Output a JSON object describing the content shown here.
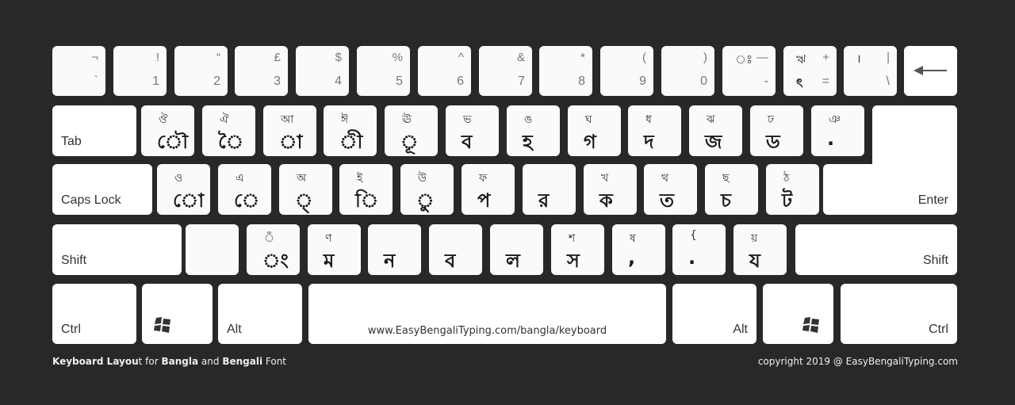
{
  "rows": {
    "number": [
      {
        "shift": "¬",
        "base": "`",
        "bangla": true
      },
      {
        "shift": "!",
        "base": "1"
      },
      {
        "shift": "“",
        "base": "2"
      },
      {
        "shift": "£",
        "base": "3"
      },
      {
        "shift": "$",
        "base": "4"
      },
      {
        "shift": "%",
        "base": "5"
      },
      {
        "shift": "^",
        "base": "6"
      },
      {
        "shift": "&",
        "base": "7"
      },
      {
        "shift": "*",
        "base": "8"
      },
      {
        "shift": "(",
        "base": "9"
      },
      {
        "shift": ")",
        "base": "0"
      },
      {
        "bshift": "ঃ",
        "shift": "—",
        "bbase": "",
        "base": "-"
      },
      {
        "bshift": "ঋ",
        "shift": "+",
        "bbase": "ৎ",
        "base": "="
      },
      {
        "bshift": "।",
        "shift": "|",
        "bbase": "",
        "base": "\\"
      }
    ],
    "top": [
      {
        "shift": "ঔ",
        "base": "ৌ"
      },
      {
        "shift": "ঐ",
        "base": "ৈ"
      },
      {
        "shift": "আ",
        "base": "া"
      },
      {
        "shift": "ঈ",
        "base": "ী"
      },
      {
        "shift": "ঊ",
        "base": "ূ"
      },
      {
        "shift": "ভ",
        "base": "ব"
      },
      {
        "shift": "ঙ",
        "base": "হ"
      },
      {
        "shift": "ঘ",
        "base": "গ"
      },
      {
        "shift": "ধ",
        "base": "দ"
      },
      {
        "shift": "ঝ",
        "base": "জ"
      },
      {
        "shift": "ঢ",
        "base": "ড"
      },
      {
        "shift": "ঞ",
        "base": "."
      }
    ],
    "home": [
      {
        "shift": "ও",
        "base": "ো"
      },
      {
        "shift": "এ",
        "base": "ে"
      },
      {
        "shift": "অ",
        "base": "্"
      },
      {
        "shift": "ই",
        "base": "ি"
      },
      {
        "shift": "উ",
        "base": "ু"
      },
      {
        "shift": "ফ",
        "base": "প"
      },
      {
        "shift": "",
        "base": "র"
      },
      {
        "shift": "খ",
        "base": "ক"
      },
      {
        "shift": "থ",
        "base": "ত"
      },
      {
        "shift": "ছ",
        "base": "চ"
      },
      {
        "shift": "ঠ",
        "base": "ট"
      }
    ],
    "bottom": [
      {
        "shift": "",
        "base": ""
      },
      {
        "shift": "ঁ",
        "base": "ং"
      },
      {
        "shift": "ণ",
        "base": "ম"
      },
      {
        "shift": "",
        "base": "ন"
      },
      {
        "shift": "",
        "base": "ব"
      },
      {
        "shift": "",
        "base": "ল"
      },
      {
        "shift": "শ",
        "base": "স"
      },
      {
        "shift": "ষ",
        "base": ","
      },
      {
        "shift": "{",
        "base": "."
      },
      {
        "shift": "য়",
        "base": "য"
      }
    ]
  },
  "labels": {
    "tab": "Tab",
    "caps": "Caps Lock",
    "enter": "Enter",
    "shift_left": "Shift",
    "shift_right": "Shift",
    "ctrl_left": "Ctrl",
    "alt_left": "Alt",
    "alt_right": "Alt",
    "ctrl_right": "Ctrl",
    "space": "www.EasyBengaliTyping.com/bangla/keyboard"
  },
  "footer": {
    "left_parts": [
      {
        "text": "Keyboard Layou",
        "bold": true
      },
      {
        "text": "t for ",
        "bold": false
      },
      {
        "text": "Bangla",
        "bold": true
      },
      {
        "text": " and ",
        "bold": false
      },
      {
        "text": "Bengali",
        "bold": true
      },
      {
        "text": " Font",
        "bold": false
      }
    ],
    "right": "copyright 2019 @ EasyBengaliTyping.com"
  },
  "colors": {
    "background": "#282828",
    "key": "#fbfaf8"
  }
}
